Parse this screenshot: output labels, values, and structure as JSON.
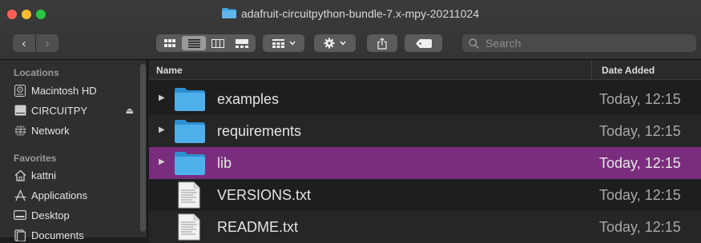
{
  "window": {
    "title": "adafruit-circuitpython-bundle-7.x-mpy-20211024"
  },
  "toolbar": {
    "back_label": "‹",
    "forward_label": "›",
    "search_placeholder": "Search",
    "view_modes": [
      "icon",
      "list",
      "column",
      "gallery"
    ],
    "active_view": "list"
  },
  "sidebar": {
    "sections": [
      {
        "heading": "Locations",
        "items": [
          {
            "label": "Macintosh HD",
            "icon": "harddisk-icon"
          },
          {
            "label": "CIRCUITPY",
            "icon": "external-drive-icon",
            "eject": "⏏"
          },
          {
            "label": "Network",
            "icon": "network-globe-icon"
          }
        ]
      },
      {
        "heading": "Favorites",
        "items": [
          {
            "label": "kattni",
            "icon": "home-icon"
          },
          {
            "label": "Applications",
            "icon": "applications-icon"
          },
          {
            "label": "Desktop",
            "icon": "desktop-icon"
          },
          {
            "label": "Documents",
            "icon": "documents-icon"
          }
        ]
      }
    ]
  },
  "columns": {
    "name": "Name",
    "date_added": "Date Added"
  },
  "files": [
    {
      "name": "examples",
      "kind": "folder",
      "date_added": "Today, 12:15",
      "selected": false
    },
    {
      "name": "requirements",
      "kind": "folder",
      "date_added": "Today, 12:15",
      "selected": false
    },
    {
      "name": "lib",
      "kind": "folder",
      "date_added": "Today, 12:15",
      "selected": true
    },
    {
      "name": "VERSIONS.txt",
      "kind": "text-file",
      "date_added": "Today, 12:15",
      "selected": false
    },
    {
      "name": "README.txt",
      "kind": "text-file",
      "date_added": "Today, 12:15",
      "selected": false
    }
  ],
  "colors": {
    "selection": "#7a2d7e",
    "folder": "#3ea4e0",
    "background": "#1e1e1e",
    "sidebar": "#2f2f31"
  }
}
